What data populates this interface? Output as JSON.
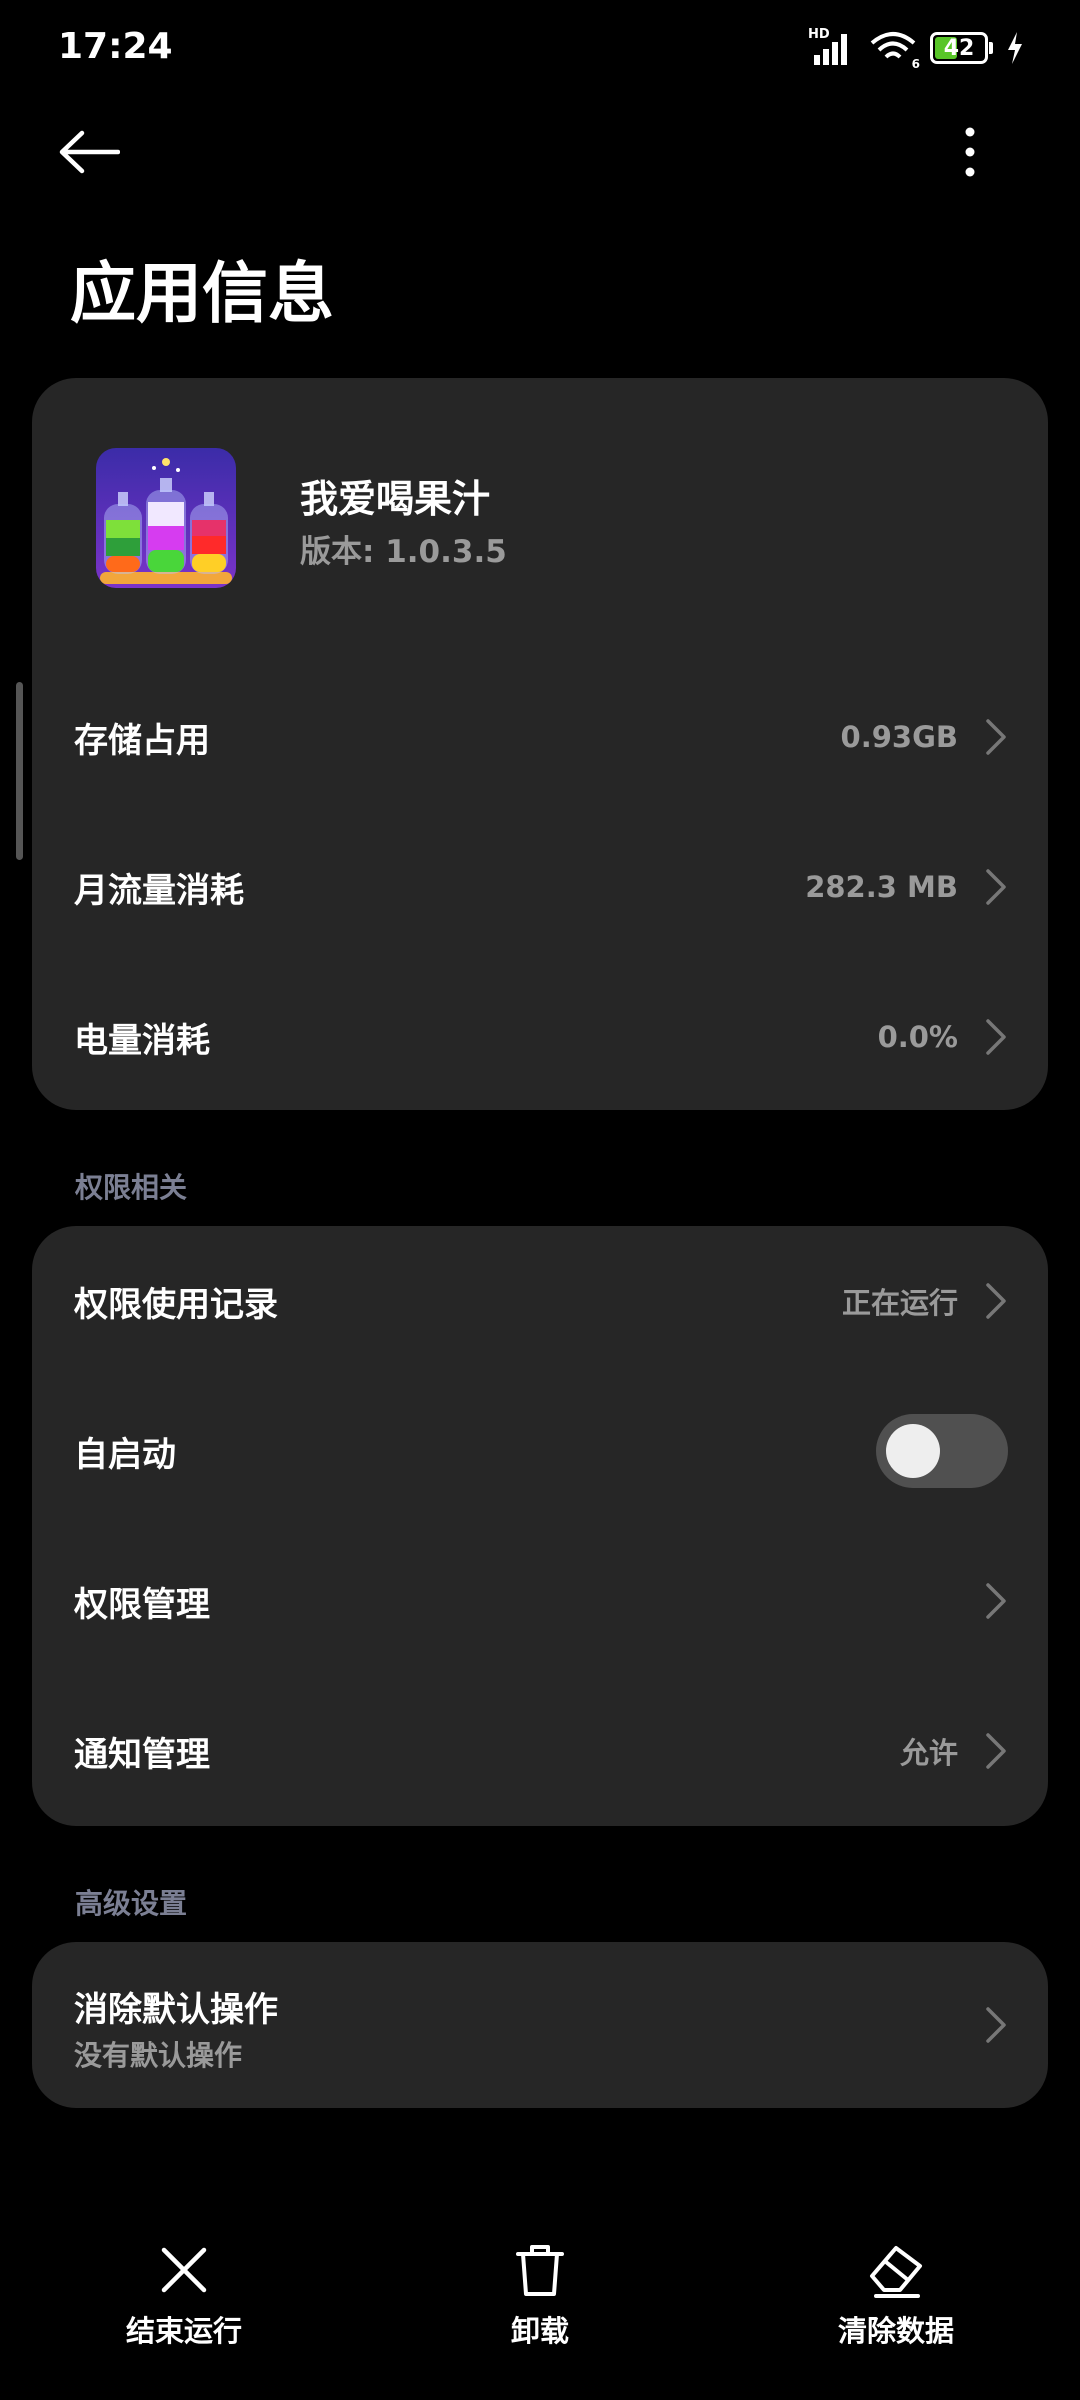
{
  "status_bar": {
    "time": "17:24",
    "battery": "42",
    "network_label": "HD",
    "wifi_badge": "6"
  },
  "header": {
    "title": "应用信息"
  },
  "app": {
    "name": "我爱喝果汁",
    "version": "版本: 1.0.3.5"
  },
  "usage": [
    {
      "label": "存储占用",
      "value": "0.93GB"
    },
    {
      "label": "月流量消耗",
      "value": "282.3 MB"
    },
    {
      "label": "电量消耗",
      "value": "0.0%"
    }
  ],
  "permissions": {
    "section_label": "权限相关",
    "record": {
      "label": "权限使用记录",
      "value": "正在运行"
    },
    "autostart": {
      "label": "自启动",
      "enabled": false
    },
    "manage": {
      "label": "权限管理"
    },
    "notify": {
      "label": "通知管理",
      "value": "允许"
    }
  },
  "advanced": {
    "section_label": "高级设置",
    "clear_default": {
      "label": "消除默认操作",
      "sub": "没有默认操作"
    }
  },
  "bottom_bar": {
    "force_stop": "结束运行",
    "uninstall": "卸载",
    "clear_data": "清除数据"
  },
  "colors": {
    "background": "#000000",
    "card": "#262626",
    "battery_fill": "#58c528",
    "section_label": "#7b7f93"
  },
  "icons": [
    "back-arrow-icon",
    "more-vertical-icon",
    "chevron-right-icon",
    "close-icon",
    "trash-icon",
    "eraser-icon",
    "signal-icon",
    "wifi-icon",
    "battery-icon",
    "charging-icon"
  ]
}
